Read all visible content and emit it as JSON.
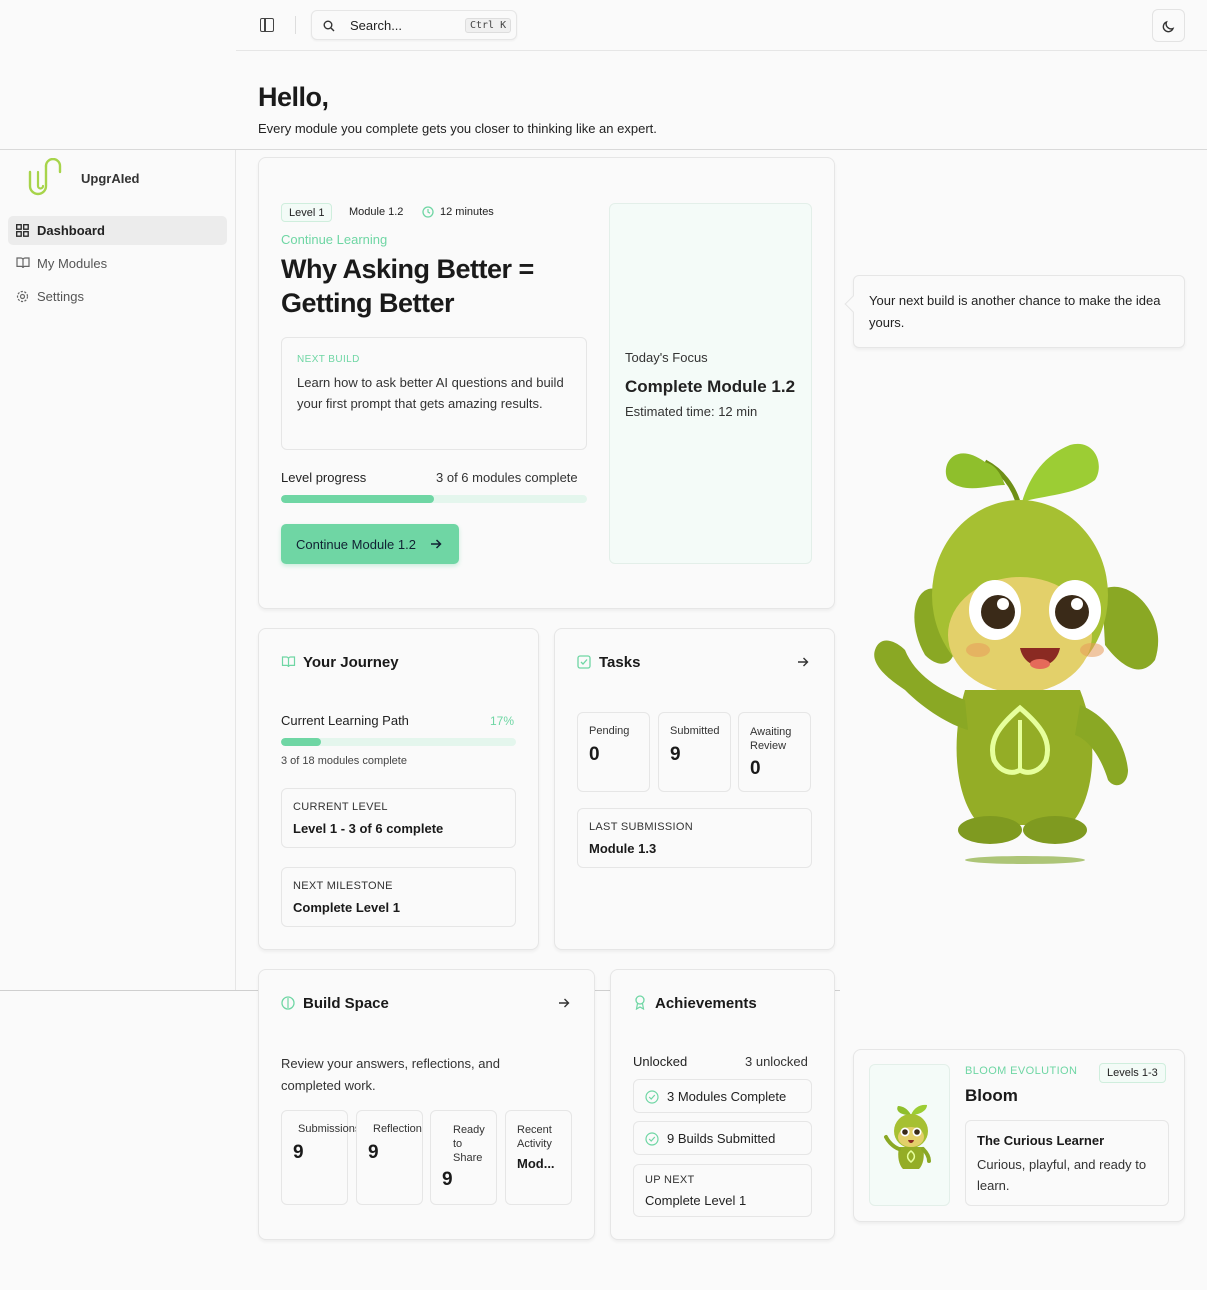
{
  "topbar": {
    "search_placeholder": "Search...",
    "shortcut": "Ctrl K"
  },
  "greeting": {
    "title": "Hello,",
    "subtitle": "Every module you complete gets you closer to thinking like an expert."
  },
  "sidebar": {
    "brand": "UpgrAIed",
    "items": [
      {
        "label": "Dashboard",
        "active": true,
        "icon": "grid-icon"
      },
      {
        "label": "My Modules",
        "active": false,
        "icon": "book-icon"
      },
      {
        "label": "Settings",
        "active": false,
        "icon": "gear-icon"
      }
    ]
  },
  "hero": {
    "level": "Level 1",
    "module": "Module 1.2",
    "duration": "12 minutes",
    "kicker": "Continue Learning",
    "title_line1": "Why Asking Better =",
    "title_line2": "Getting Better",
    "next_build_label": "NEXT BUILD",
    "next_build_text": "Learn how to ask better AI questions and build your first prompt that gets amazing results.",
    "progress_label": "Level progress",
    "progress_text": "3 of 6 modules complete",
    "progress_fraction": 0.5,
    "cta": "Continue Module 1.2"
  },
  "focus": {
    "label": "Today's Focus",
    "title": "Complete Module 1.2",
    "estimate": "Estimated time: 12 min"
  },
  "speech": {
    "text": "Your next build is another chance to make the idea yours."
  },
  "journey": {
    "title": "Your Journey",
    "path_label": "Current Learning Path",
    "path_percent": "17%",
    "path_fraction": 0.17,
    "path_sub": "3 of 18 modules complete",
    "current_level_label": "CURRENT LEVEL",
    "current_level_value": "Level 1 - 3 of 6 complete",
    "milestone_label": "NEXT MILESTONE",
    "milestone_value": "Complete Level 1"
  },
  "tasks": {
    "title": "Tasks",
    "stats": [
      {
        "label": "Pending",
        "value": "0"
      },
      {
        "label": "Submitted",
        "value": "9"
      },
      {
        "label": "Awaiting Review",
        "value": "0"
      }
    ],
    "last_label": "LAST SUBMISSION",
    "last_value": "Module 1.3"
  },
  "build": {
    "title": "Build Space",
    "desc": "Review your answers, reflections, and completed work.",
    "stats": [
      {
        "label": "Submissions",
        "value": "9"
      },
      {
        "label": "Reflections",
        "value": "9"
      },
      {
        "label": "Ready to Share",
        "value": "9"
      },
      {
        "label": "Recent Activity",
        "value": "Mod..."
      }
    ]
  },
  "achievements": {
    "title": "Achievements",
    "unlocked_label": "Unlocked",
    "unlocked_count": "3 unlocked",
    "items": [
      "3 Modules Complete",
      "9 Builds Submitted"
    ],
    "upnext_label": "UP NEXT",
    "upnext_value": "Complete Level 1"
  },
  "bloom": {
    "kicker": "BLOOM EVOLUTION",
    "levels": "Levels 1-3",
    "name": "Bloom",
    "stage_title": "The Curious Learner",
    "stage_desc": "Curious, playful, and ready to learn."
  },
  "colors": {
    "accent": "#6fd6a4",
    "mascot": "#9bb52a"
  }
}
